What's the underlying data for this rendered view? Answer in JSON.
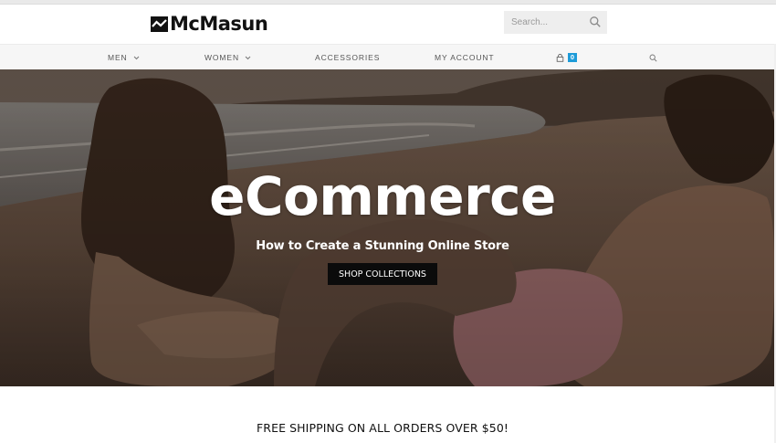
{
  "brand": {
    "name": "McMasun"
  },
  "search": {
    "placeholder": "Search..."
  },
  "nav": {
    "items": [
      {
        "label": "MEN",
        "has_dropdown": true
      },
      {
        "label": "WOMEN",
        "has_dropdown": true
      },
      {
        "label": "ACCESSORIES",
        "has_dropdown": false
      },
      {
        "label": "MY ACCOUNT",
        "has_dropdown": false
      }
    ],
    "cart_count": "0"
  },
  "hero": {
    "title": "eCommerce",
    "subtitle": "How to Create a Stunning Online Store",
    "button_label": "SHOP COLLECTIONS"
  },
  "promo": {
    "text": "FREE SHIPPING ON ALL ORDERS OVER $50!"
  },
  "colors": {
    "accent": "#1e9bd8",
    "button_bg": "#0b0b0b",
    "nav_bg": "#f6f6f6",
    "search_bg": "#eeeeee"
  },
  "icons": [
    "logo-mark-icon",
    "search-icon",
    "chevron-down-icon",
    "cart-icon",
    "nav-search-icon"
  ]
}
